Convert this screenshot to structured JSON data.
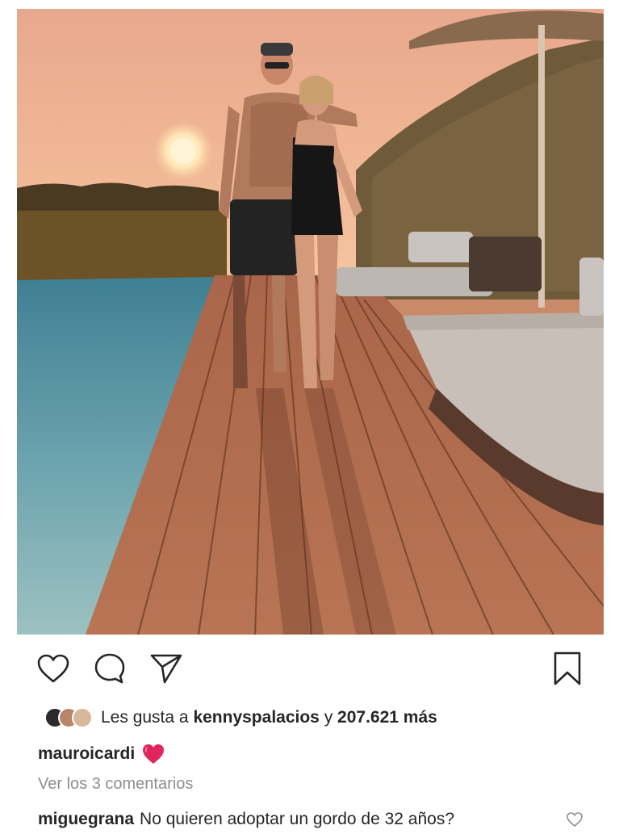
{
  "post": {
    "image_alt": "Couple standing on a wooden pool deck at sunset",
    "icons": {
      "like": "heart-outline-icon",
      "comment": "comment-bubble-icon",
      "share": "paper-plane-icon",
      "save": "bookmark-icon"
    },
    "likes": {
      "prefix": "Les gusta a",
      "user": "kennyspalacios",
      "joiner": "y",
      "count": "207.621 más"
    },
    "caption": {
      "username": "mauroicardi",
      "emoji": "red-heart"
    },
    "view_comments": "Ver los 3 comentarios",
    "comment": {
      "username": "miguegrana",
      "text": "No quieren adoptar un gordo de 32 años?"
    }
  },
  "colors": {
    "text": "#262626",
    "muted": "#8e8e8e",
    "heart_red": "#e0245e"
  }
}
